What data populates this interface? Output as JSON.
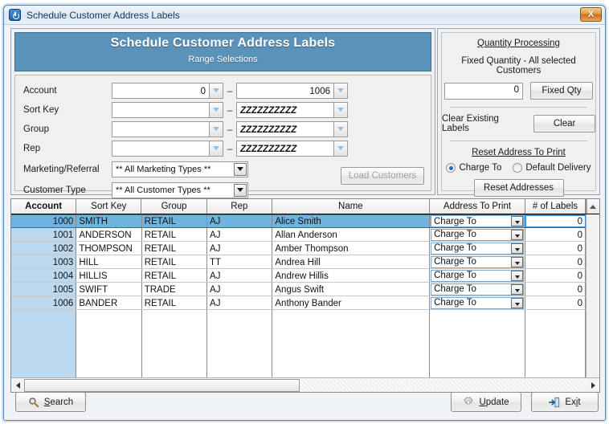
{
  "window": {
    "title": "Schedule Customer Address Labels",
    "app_icon": "power-icon",
    "close_label": "X"
  },
  "range_panel": {
    "header_title": "Schedule Customer Address Labels",
    "header_subtitle": "Range Selections",
    "header_color": "#5b92b9",
    "rows": [
      {
        "label": "Account",
        "from": "0",
        "to": "1006",
        "type": "number"
      },
      {
        "label": "Sort Key",
        "from": "",
        "to": "ZZZZZZZZZZ",
        "type": "text"
      },
      {
        "label": "Group",
        "from": "",
        "to": "ZZZZZZZZZZ",
        "type": "text"
      },
      {
        "label": "Rep",
        "from": "",
        "to": "ZZZZZZZZZZ",
        "type": "text"
      }
    ],
    "marketing_label": "Marketing/Referral",
    "marketing_value": "** All Marketing Types **",
    "customer_type_label": "Customer Type",
    "customer_type_value": "** All Customer Types **",
    "load_customers_label": "Load Customers",
    "dash": "–"
  },
  "quantity_panel": {
    "title": "Quantity Processing",
    "fixed_qty_caption": "Fixed Quantity - All selected Customers",
    "fixed_qty_value": "0",
    "fixed_qty_button": "Fixed Qty",
    "clear_caption": "Clear Existing Labels",
    "clear_button": "Clear",
    "reset_title": "Reset Address To Print",
    "radio_charge_to": "Charge To",
    "radio_default_delivery": "Default Delivery",
    "radio_selected": "Charge To",
    "reset_button": "Reset Addresses"
  },
  "grid": {
    "columns": [
      {
        "key": "account",
        "label": "Account",
        "bold": true
      },
      {
        "key": "sortkey",
        "label": "Sort Key",
        "bold": false
      },
      {
        "key": "group",
        "label": "Group",
        "bold": false
      },
      {
        "key": "rep",
        "label": "Rep",
        "bold": false
      },
      {
        "key": "name",
        "label": "Name",
        "bold": false
      },
      {
        "key": "address",
        "label": "Address To Print",
        "bold": false
      },
      {
        "key": "labels",
        "label": "# of Labels",
        "bold": false
      }
    ],
    "rows": [
      {
        "account": "1000",
        "sortkey": "SMITH",
        "group": "RETAIL",
        "rep": "AJ",
        "name": "Alice Smith",
        "address": "Charge To",
        "labels": "0",
        "selected": true
      },
      {
        "account": "1001",
        "sortkey": "ANDERSON",
        "group": "RETAIL",
        "rep": "AJ",
        "name": "Allan Anderson",
        "address": "Charge To",
        "labels": "0",
        "selected": false
      },
      {
        "account": "1002",
        "sortkey": "THOMPSON",
        "group": "RETAIL",
        "rep": "AJ",
        "name": "Amber Thompson",
        "address": "Charge To",
        "labels": "0",
        "selected": false
      },
      {
        "account": "1003",
        "sortkey": "HILL",
        "group": "RETAIL",
        "rep": "TT",
        "name": "Andrea Hill",
        "address": "Charge To",
        "labels": "0",
        "selected": false
      },
      {
        "account": "1004",
        "sortkey": "HILLIS",
        "group": "RETAIL",
        "rep": "AJ",
        "name": "Andrew Hillis",
        "address": "Charge To",
        "labels": "0",
        "selected": false
      },
      {
        "account": "1005",
        "sortkey": "SWIFT",
        "group": "TRADE",
        "rep": "AJ",
        "name": "Angus Swift",
        "address": "Charge To",
        "labels": "0",
        "selected": false
      },
      {
        "account": "1006",
        "sortkey": "BANDER",
        "group": "RETAIL",
        "rep": "AJ",
        "name": "Anthony Bander",
        "address": "Charge To",
        "labels": "0",
        "selected": false
      }
    ],
    "selected_row_color": "#6fb3e0",
    "account_column_color": "#bcd8ee"
  },
  "footer": {
    "search_label": "Search",
    "update_label": "Update",
    "exit_label": "Exit"
  }
}
